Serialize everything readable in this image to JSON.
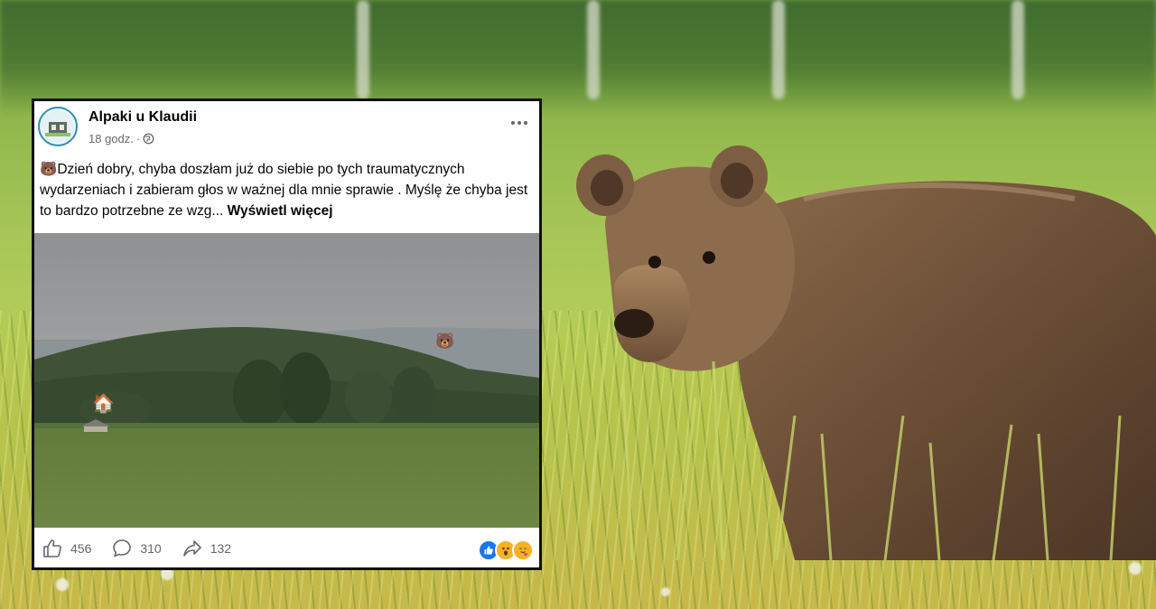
{
  "post": {
    "page_name": "Alpaki u Klaudii",
    "time": "18 godz.",
    "separator": "·",
    "visibility_icon": "globe-icon",
    "more_icon": "more-options-icon",
    "text_emoji": "🐻",
    "text": "Dzień dobry, chyba doszłam już do siebie po tych traumatycznych wydarzeniach i zabieram głos w ważnej dla mnie sprawie . Myślę że chyba jest to bardzo potrzebne ze wzg... ",
    "see_more": "Wyświetl więcej",
    "photo_emojis": {
      "bear": "🐻",
      "house": "🏠"
    },
    "likes": "456",
    "comments": "310",
    "shares": "132",
    "reaction_icons": [
      "like-icon",
      "wow-icon",
      "care-icon"
    ]
  },
  "colors": {
    "like_blue": "#1877f2",
    "text_primary": "#050505",
    "text_secondary": "#65676b"
  }
}
